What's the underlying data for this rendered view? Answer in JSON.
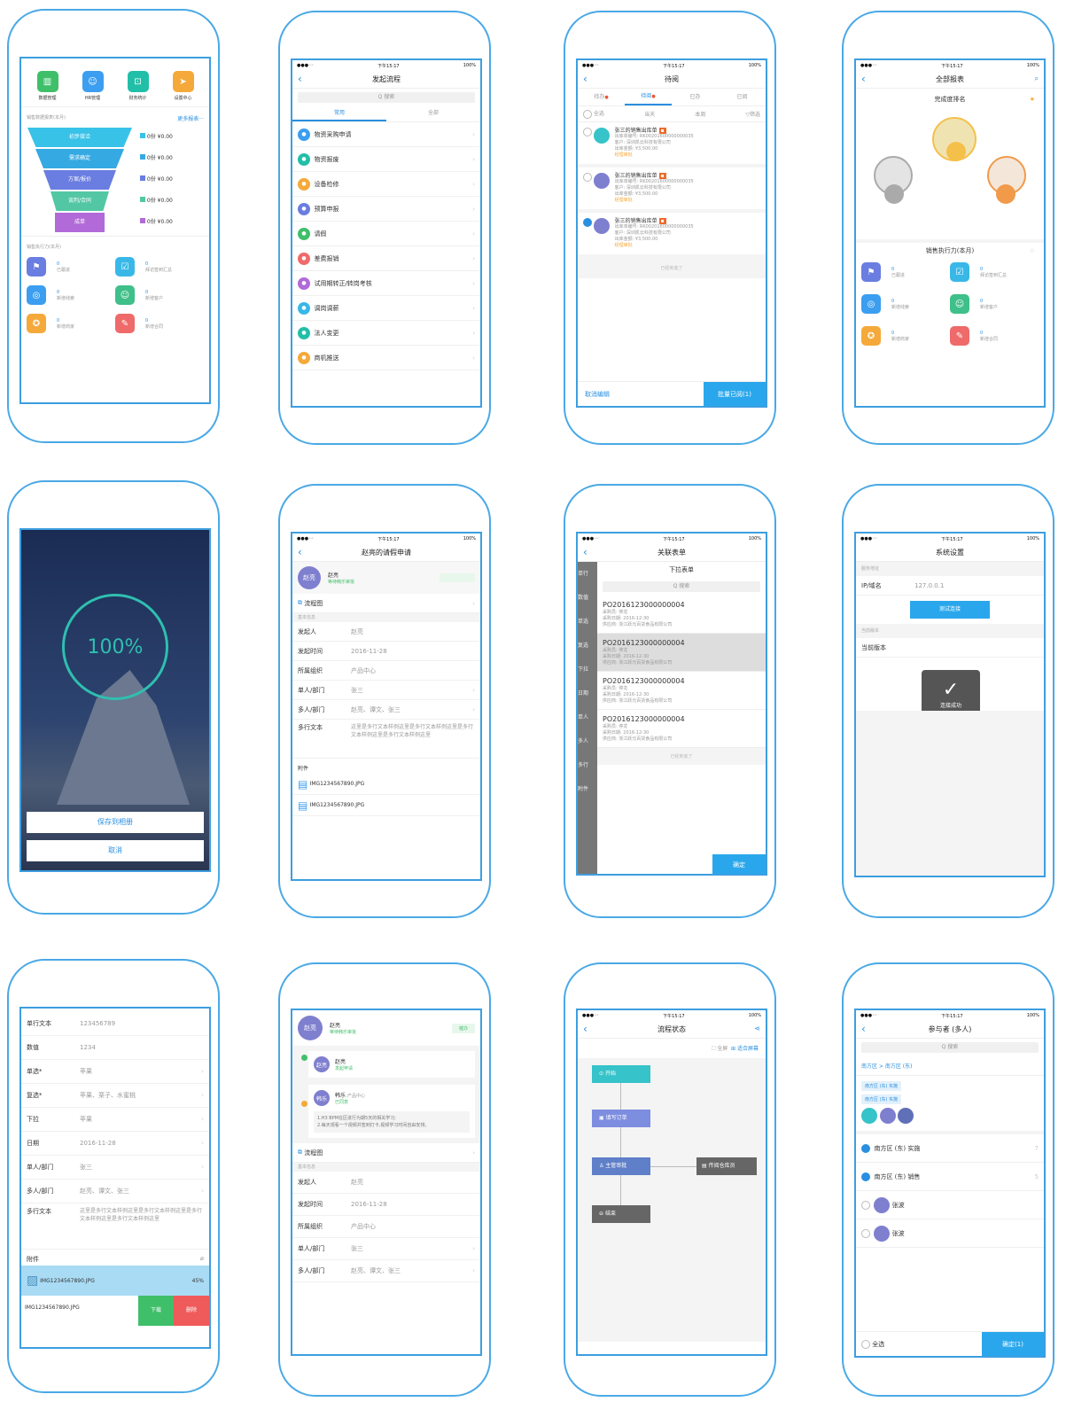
{
  "p1": {
    "apps": [
      "数据管理",
      "HR管理",
      "财务统计",
      "设置中心"
    ],
    "funnel_title": "销售数据报表(本月)",
    "more": "更多报表···",
    "funnel": [
      "初步接洽",
      "需求确定",
      "方案/报价",
      "谈判/合同",
      "成单"
    ],
    "legend": [
      "0份 ¥0.00",
      "0份 ¥0.00",
      "0份 ¥0.00",
      "0份 ¥0.00",
      "0份 ¥0.00"
    ],
    "exec_title": "销售执行力(本月)",
    "exec": [
      {
        "n": "0",
        "l": "已跟进"
      },
      {
        "n": "0",
        "l": "拜访签到汇总"
      },
      {
        "n": "0",
        "l": "新增线索"
      },
      {
        "n": "0",
        "l": "新增客户"
      },
      {
        "n": "0",
        "l": "新增商家"
      },
      {
        "n": "0",
        "l": "新增合同"
      }
    ]
  },
  "p2": {
    "title": "发起流程",
    "search": "Q 搜索",
    "tabs": [
      "常用",
      "全部"
    ],
    "items": [
      "物资采购申请",
      "物资报废",
      "设备检修",
      "预算申报",
      "请假",
      "差费报销",
      "试用期转正/转岗考核",
      "调岗调薪",
      "法人变更",
      "商机推送"
    ]
  },
  "p3": {
    "title": "待阅",
    "tabs": [
      "待办",
      "待阅",
      "已办",
      "已阅"
    ],
    "filters": [
      "全选",
      "当天",
      "本周",
      "筛选"
    ],
    "items": [
      {
        "t": "张三的销售出库单",
        "l1": "出库单编号: RK00201600000000035",
        "l2": "客户: 深圳凯云科技有限公司",
        "l3": "出库金额: ¥3,500.00",
        "s": "经理审批"
      },
      {
        "t": "张三的销售出库单",
        "l1": "出库单编号: RK00201600000000035",
        "l2": "客户: 深圳凯云科技有限公司",
        "l3": "出库金额: ¥3,500.00",
        "s": "经理审批"
      },
      {
        "t": "张三的销售出库单",
        "l1": "出库单编号: RK00201600000000035",
        "l2": "客户: 深圳凯云科技有限公司",
        "l3": "出库金额: ¥3,500.00",
        "s": "经理审批"
      }
    ],
    "end": "已经到底了",
    "cancel": "取消编辑",
    "batch": "批量已阅(1)"
  },
  "p4": {
    "title": "全部报表",
    "rank": "完成度排名",
    "exec_title": "销售执行力(本月)",
    "exec": [
      {
        "n": "0",
        "l": "已跟进"
      },
      {
        "n": "0",
        "l": "拜访签到汇总"
      },
      {
        "n": "0",
        "l": "新增线索"
      },
      {
        "n": "0",
        "l": "新增客户"
      },
      {
        "n": "0",
        "l": "新增商家"
      },
      {
        "n": "0",
        "l": "新增合同"
      }
    ]
  },
  "p5": {
    "progress": "100%",
    "save": "保存到相册",
    "cancel": "取消"
  },
  "p6": {
    "title": "赵亮的请假申请",
    "name": "赵亮",
    "status": "等待韩乐审批",
    "flow": "流程图",
    "sec": "基本信息",
    "rows": [
      [
        "发起人",
        "赵亮"
      ],
      [
        "发起时间",
        "2016-11-28"
      ],
      [
        "所属组织",
        "产品中心"
      ],
      [
        "单人/部门",
        "张三"
      ],
      [
        "多人/部门",
        "赵亮、谭文、张三"
      ]
    ],
    "multi_k": "多行文本",
    "multi_v": "这里是多行文本样例这里是多行文本样例这里是多行文本样例这里是多行文本样例这里",
    "att": "附件",
    "files": [
      "IMG1234567890.JPG",
      "IMG1234567890.JPG"
    ]
  },
  "p7": {
    "title": "关联表单",
    "sub": "下拉表单",
    "search": "Q 搜索",
    "side": [
      "单行",
      "数值",
      "单选",
      "复选",
      "下拉",
      "日期",
      "单人",
      "多人",
      "多行",
      "附件"
    ],
    "items": [
      {
        "no": "PO2016123000000004",
        "a": "采购员: 停龙",
        "b": "采购日期: 2016-12-30",
        "c": "供应商: 浙江跃元百货食品有限公司"
      },
      {
        "no": "PO2016123000000004",
        "a": "采购员: 停龙",
        "b": "采购日期: 2016-12-30",
        "c": "供应商: 浙江跃元百货食品有限公司"
      },
      {
        "no": "PO2016123000000004",
        "a": "采购员: 停龙",
        "b": "采购日期: 2016-12-30",
        "c": "供应商: 浙江跃元百货食品有限公司"
      },
      {
        "no": "PO2016123000000004",
        "a": "采购员: 停龙",
        "b": "采购日期: 2016-12-30",
        "c": "供应商: 浙江跃元百货食品有限公司"
      }
    ],
    "end": "已经到底了",
    "ok": "确定"
  },
  "p8": {
    "title": "系统设置",
    "sec1": "服务地址",
    "ip_k": "IP/域名",
    "ip_v": "127.0.0.1",
    "test": "测试连接",
    "sec2": "当前版本",
    "ver_k": "当前版本",
    "toast": "连接成功"
  },
  "p9": {
    "rows": [
      [
        "单行文本",
        "123456789"
      ],
      [
        "数值",
        "1234"
      ],
      [
        "单选*",
        "苹果"
      ],
      [
        "复选*",
        "苹果、栗子、水蜜桃"
      ],
      [
        "下拉",
        "苹果"
      ],
      [
        "日期",
        "2016-11-28"
      ],
      [
        "单人/部门",
        "张三"
      ],
      [
        "多人/部门",
        "赵亮、谭文、张三"
      ]
    ],
    "multi_k": "多行文本",
    "multi_v": "这里是多行文本样例这里是多行文本样例这里是多行文本样例这里是多行文本样例这里",
    "att": "附件",
    "file1": "IMG1234567890.JPG",
    "pct": "45%",
    "file2": "IMG1234567890.JPG",
    "dl": "下载",
    "del": "删除"
  },
  "p10": {
    "name": "赵亮",
    "status": "等待韩乐审批",
    "urge": "催办",
    "n1": "赵亮",
    "s1": "发起申请",
    "n2": "韩乐",
    "org": "产品中心",
    "s2": "已同意",
    "note": "1.H3 BPM在区进行为期5天的相关学习;\n2.每天观看一个视频并签到打卡,视频学习时间自由安排。",
    "flow": "流程图",
    "sec": "基本信息",
    "rows": [
      [
        "发起人",
        "赵亮"
      ],
      [
        "发起时间",
        "2016-11-28"
      ],
      [
        "所属组织",
        "产品中心"
      ],
      [
        "单人/部门",
        "张三"
      ],
      [
        "多人/部门",
        "赵亮、谭文、张三"
      ]
    ]
  },
  "p11": {
    "title": "流程状态",
    "full": "全屏",
    "fit": "适合屏幕",
    "nodes": [
      "开始",
      "填写订单",
      "主管审批",
      "传阅仓库员",
      "结束"
    ]
  },
  "p12": {
    "title": "参与者 (多人)",
    "search": "Q 搜索",
    "crumb": "南方区 > 南方区 (东)",
    "tags": [
      "南方区 (东) 实施",
      "南方区 (东) 实施"
    ],
    "list": [
      {
        "t": "南方区 (东) 实施",
        "c": "7"
      },
      {
        "t": "南方区 (东) 销售",
        "c": "5"
      },
      {
        "t": "张波",
        "c": ""
      },
      {
        "t": "张波",
        "c": ""
      }
    ],
    "all": "全选",
    "ok": "确定(1)"
  },
  "status": {
    "time": "下午15:17",
    "batt": "100%"
  }
}
